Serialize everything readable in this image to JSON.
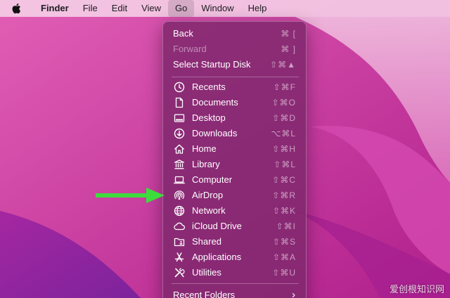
{
  "menubar": {
    "items": [
      {
        "label": "Finder"
      },
      {
        "label": "File"
      },
      {
        "label": "Edit"
      },
      {
        "label": "View"
      },
      {
        "label": "Go"
      },
      {
        "label": "Window"
      },
      {
        "label": "Help"
      }
    ],
    "active_item": "Go"
  },
  "go_menu": {
    "items": [
      {
        "label": "Back",
        "shortcut": "⌘ [",
        "enabled": true
      },
      {
        "label": "Forward",
        "shortcut": "⌘ ]",
        "enabled": false
      },
      {
        "label": "Select Startup Disk",
        "shortcut": "⇧⌘▲",
        "enabled": true
      },
      {
        "label": "Recents",
        "shortcut": "⇧⌘F",
        "icon": "clock-icon"
      },
      {
        "label": "Documents",
        "shortcut": "⇧⌘O",
        "icon": "document-icon"
      },
      {
        "label": "Desktop",
        "shortcut": "⇧⌘D",
        "icon": "desktop-icon"
      },
      {
        "label": "Downloads",
        "shortcut": "⌥⌘L",
        "icon": "download-icon"
      },
      {
        "label": "Home",
        "shortcut": "⇧⌘H",
        "icon": "home-icon"
      },
      {
        "label": "Library",
        "shortcut": "⇧⌘L",
        "icon": "library-icon"
      },
      {
        "label": "Computer",
        "shortcut": "⇧⌘C",
        "icon": "computer-icon"
      },
      {
        "label": "AirDrop",
        "shortcut": "⇧⌘R",
        "icon": "airdrop-icon"
      },
      {
        "label": "Network",
        "shortcut": "⇧⌘K",
        "icon": "globe-icon"
      },
      {
        "label": "iCloud Drive",
        "shortcut": "⇧⌘I",
        "icon": "cloud-icon"
      },
      {
        "label": "Shared",
        "shortcut": "⇧⌘S",
        "icon": "shared-folder-icon"
      },
      {
        "label": "Applications",
        "shortcut": "⇧⌘A",
        "icon": "applications-icon"
      },
      {
        "label": "Utilities",
        "shortcut": "⇧⌘U",
        "icon": "utilities-icon"
      },
      {
        "label": "Recent Folders",
        "shortcut": "›",
        "submenu": true
      }
    ]
  },
  "annotation": {
    "arrow_color": "#3ddc3d",
    "points_to": "AirDrop"
  },
  "watermark": {
    "text": "爱创根知识网"
  },
  "colors": {
    "menu_bg": "#80286e",
    "menubar_bg": "#f6d2e8",
    "wallpaper": "#c8329d"
  }
}
